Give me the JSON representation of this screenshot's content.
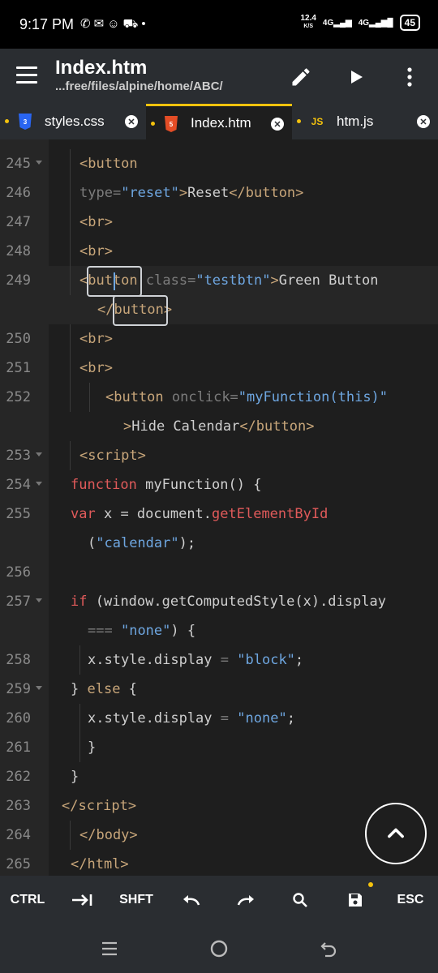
{
  "status_bar": {
    "time": "9:17 PM",
    "notification_icons": [
      "whatsapp-icon",
      "chat-icon",
      "snapchat-icon",
      "shopping-cart-icon",
      "dot-icon"
    ],
    "net_speed_value": "12.4",
    "net_speed_unit": "K/S",
    "sim1": "4G",
    "sim2": "4G",
    "battery": "45"
  },
  "app_bar": {
    "title": "Index.htm",
    "path": "...free/files/alpine/home/ABC/",
    "icons": [
      "menu-icon",
      "pencil-icon",
      "play-icon",
      "more-vert-icon"
    ]
  },
  "tabs": [
    {
      "label": "styles.css",
      "icon": "css",
      "active": false
    },
    {
      "label": "Index.htm",
      "icon": "html",
      "active": true
    },
    {
      "label": "htm.js",
      "icon": "JS",
      "active": false
    }
  ],
  "editor": {
    "line_numbers": [
      "245",
      "246",
      "247",
      "248",
      "249",
      "250",
      "251",
      "252",
      "253",
      "254",
      "255",
      "256",
      "257",
      "258",
      "259",
      "260",
      "261",
      "262",
      "263",
      "264",
      "265"
    ]
  },
  "key_bar": {
    "ctrl": "CTRL",
    "shift": "SHFT",
    "esc": "ESC",
    "icons": [
      "tab-icon",
      "undo-icon",
      "redo-icon",
      "search-icon",
      "save-icon"
    ]
  },
  "colors": {
    "accent": "#f4c20d",
    "tag": "#c8a67a",
    "string": "#6ea6e0",
    "keyword": "#e05a5a",
    "background": "#1e1e1e"
  }
}
